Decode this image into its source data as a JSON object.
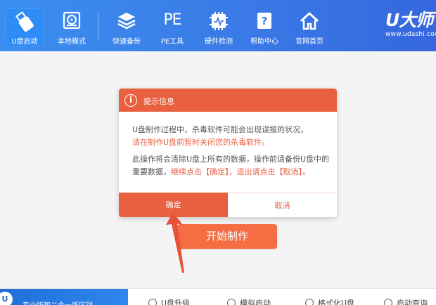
{
  "toolbar": {
    "items": [
      {
        "label": "U盘启动",
        "icon": "usb-drive-icon"
      },
      {
        "label": "本地模式",
        "icon": "local-disk-icon"
      },
      {
        "label": "快速备份",
        "icon": "layers-icon"
      },
      {
        "label": "PE工具",
        "icon": "pe-text-icon",
        "icon_text": "PE"
      },
      {
        "label": "硬件检测",
        "icon": "hardware-chip-icon"
      },
      {
        "label": "帮助中心",
        "icon": "help-book-icon"
      },
      {
        "label": "官网首页",
        "icon": "home-icon"
      }
    ],
    "active_index": 0
  },
  "brand": {
    "logo": "U大师",
    "url": "www.udashi.com"
  },
  "dialog": {
    "title": "提示信息",
    "line1": "U盘制作过程中，杀毒软件可能会出现误报的状况，",
    "line2": "请在制作U盘前暂时关闭您的杀毒软件。",
    "para2_a": "此操作将会清除U盘上所有的数据，操作前请备份U盘中的重要数据，",
    "para2_b": "继续点击【确定】，退出请点击【取消】。",
    "ok_label": "确定",
    "cancel_label": "取消"
  },
  "start_button": {
    "label": "开始制作"
  },
  "bottom": {
    "promo_text": "专业版和二合一版区别",
    "promo_badge": "U",
    "items": [
      "U盘升级",
      "模拟启动",
      "格式化U盘",
      "启动查询"
    ]
  },
  "colors": {
    "accent": "#e8603f",
    "toolbar_blue": "#3a7ae6",
    "start_button": "#f46d43"
  }
}
